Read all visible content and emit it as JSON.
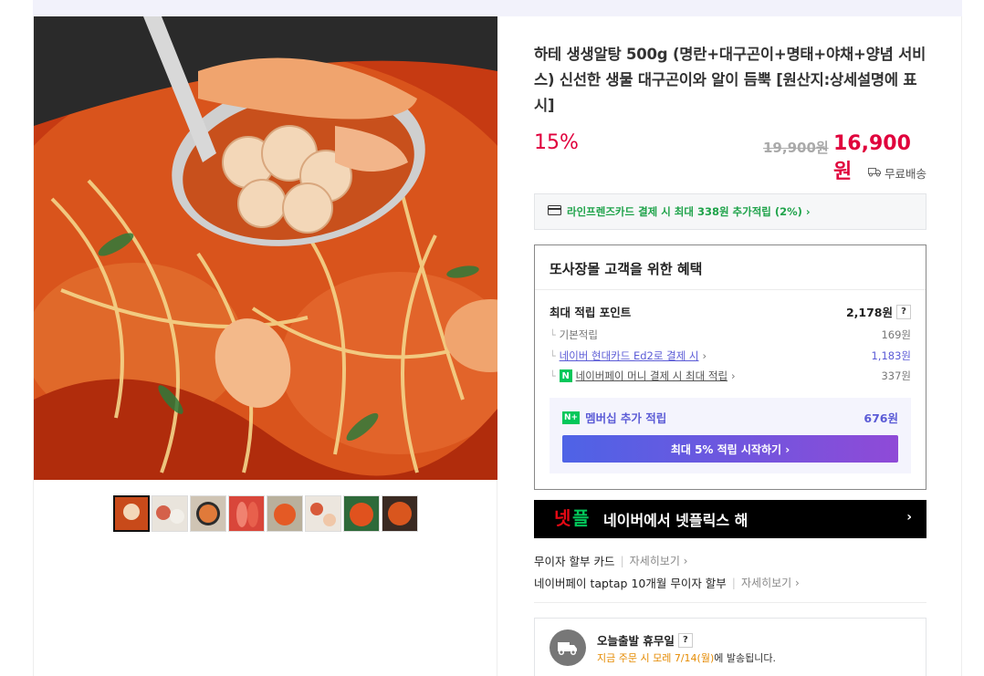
{
  "product": {
    "title": "하테 생생알탕 500g (명란+대구곤이+명태+야채+양념 서비스) 신선한 생물 대구곤이와 알이 듬뿍 [원산지:상세설명에 표시]",
    "discount": "15%",
    "original_price": "19,900원",
    "sale_price": "16,900원",
    "shipping": "무료배송",
    "thumbnail_count": 8
  },
  "card_promo": "라인프렌즈카드 결제 시 최대 338원 추가적립 (2%) ›",
  "benefit": {
    "title": "또사장몰 고객을 위한 혜택",
    "max_points_label": "최대 적립 포인트",
    "max_points_value": "2,178원",
    "help": "?",
    "rows": [
      {
        "label": "기본적립",
        "value": "169원"
      },
      {
        "label": "네이버 현대카드 Ed2로 결제 시",
        "value": "1,183원"
      },
      {
        "label": "네이버페이 머니 결제 시 최대 적립",
        "value": "337원"
      }
    ],
    "membership_label": "멤버십 추가 적립",
    "membership_value": "676원",
    "membership_button": "최대 5% 적립 시작하기 ›"
  },
  "netflix_banner": "네이버에서 넷플릭스 해",
  "interest_free": [
    {
      "label": "무이자 할부 카드",
      "more": "자세히보기 ›"
    },
    {
      "label": "네이버페이 taptap 10개월 무이자 할부",
      "more": "자세히보기 ›"
    }
  ],
  "delivery": {
    "title": "오늘출발 휴무일",
    "help": "?",
    "highlight": "지금 주문 시 모레 7/14(월)",
    "suffix": "에 발송됩니다."
  },
  "colors": {
    "accent_red": "#e0003c",
    "naver_green": "#03c75a",
    "membership_purple": "#5b5bd6"
  }
}
